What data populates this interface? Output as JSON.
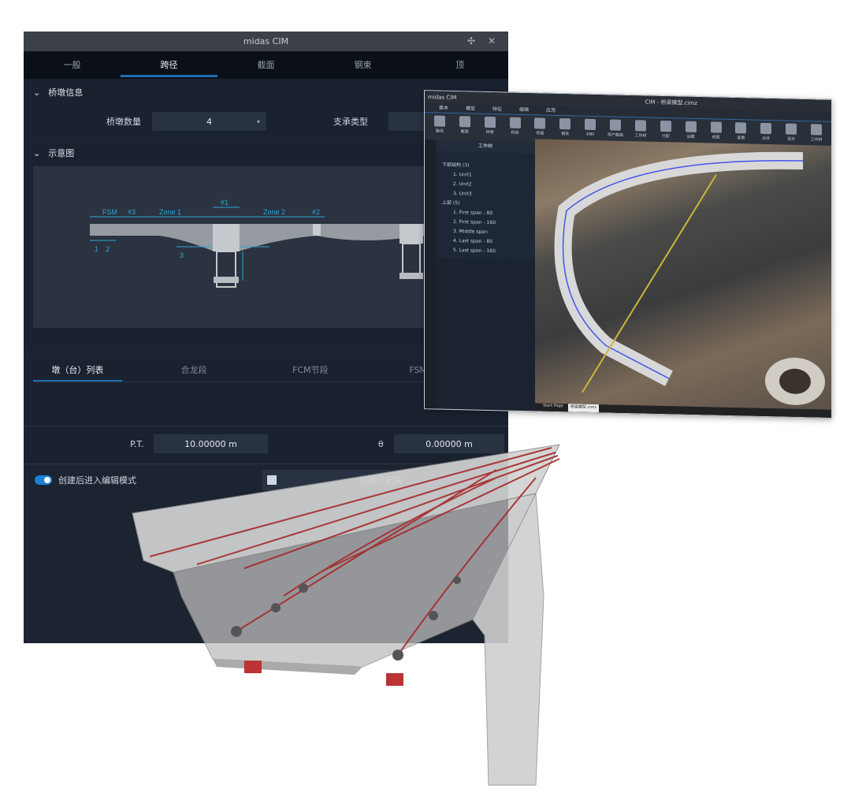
{
  "dialog": {
    "title": "midas CIM",
    "tabs": [
      "一般",
      "跨径",
      "截面",
      "钢束",
      "顶"
    ],
    "active_tab": 1,
    "section1": {
      "title": "桥墩信息",
      "pier_count_label": "桥墩数量",
      "pier_count_value": "4",
      "support_label": "支承类型"
    },
    "section2": {
      "title": "示意图",
      "labels": {
        "fsm": "FSM",
        "k3": "#3",
        "zone1": "Zone 1",
        "k1": "#1",
        "zone2": "Zone 2",
        "k2": "#2",
        "n1": "1",
        "n2": "2",
        "n3": "3"
      }
    },
    "subtabs": [
      "墩（台）列表",
      "合龙段",
      "FCM节段",
      "FSM节段"
    ],
    "pt_label": "P.T.",
    "pt_value": "10.00000 m",
    "theta_label": "θ",
    "theta_value": "0.00000 m",
    "toggle_label": "创建后进入编辑模式",
    "toggle_on": true,
    "create_button": "创建示配块"
  },
  "window2": {
    "app": "midas CIM",
    "title": "CIM - 桥梁模型.cimz",
    "menu": [
      "基本",
      "模型",
      "特征",
      "编辑",
      "应用"
    ],
    "ribbon": [
      "路线",
      "截面",
      "桥墩",
      "桥梁",
      "荷载",
      "钢束",
      "材料",
      "用户截面",
      "工作树",
      "分配",
      "设置",
      "视图",
      "查看",
      "合并",
      "显示",
      "工作树"
    ],
    "panel_title": "工作树",
    "tree": [
      {
        "group": "下部结构 (3)",
        "items": [
          "1. Unit1",
          "2. Unit2",
          "3. Unit3"
        ]
      },
      {
        "group": "上部 (5)",
        "items": [
          "1. First span - 80",
          "2. First span - 160",
          "3. Middle span",
          "4. Last span - 80",
          "5. Last span - 160"
        ]
      }
    ],
    "doc_tabs": [
      "Start Page",
      "桥梁模型.cimz"
    ]
  }
}
